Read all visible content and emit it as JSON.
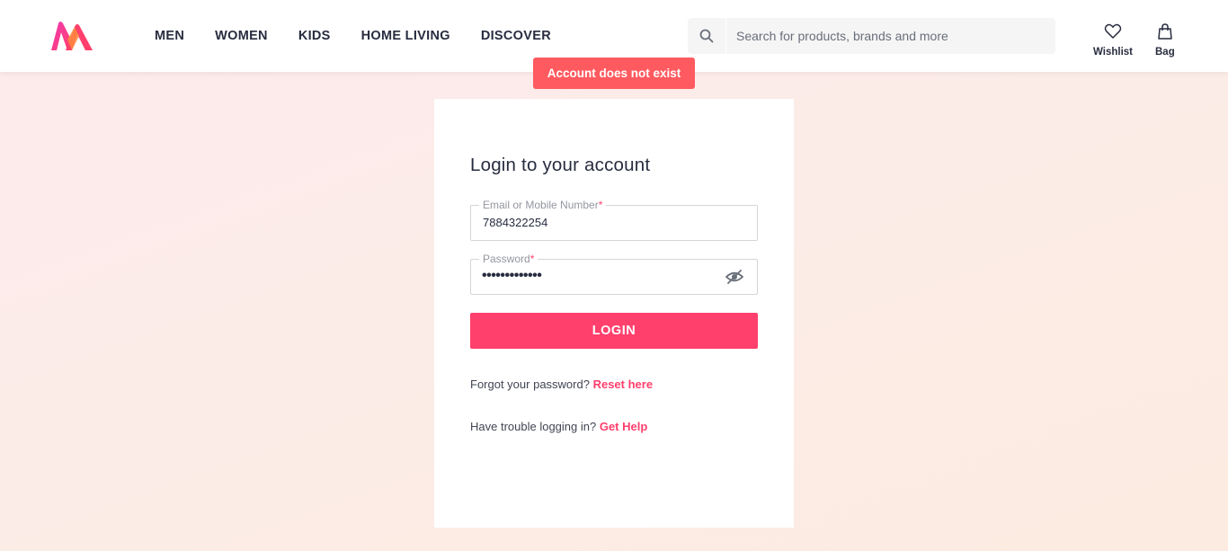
{
  "header": {
    "nav": [
      "MEN",
      "WOMEN",
      "KIDS",
      "HOME LIVING",
      "DISCOVER"
    ],
    "search_placeholder": "Search for products, brands and more",
    "wishlist_label": "Wishlist",
    "bag_label": "Bag"
  },
  "toast": {
    "message": "Account does not exist",
    "color": "#ff5a5f"
  },
  "login": {
    "title": "Login to your account",
    "email_label": "Email or Mobile Number",
    "email_value": "7884322254",
    "password_label": "Password",
    "password_mask": "•••••••••••••",
    "required_mark": "*",
    "login_button": "LOGIN",
    "forgot_text": "Forgot your password?",
    "reset_link": "Reset here",
    "trouble_text": "Have trouble logging in?",
    "help_link": "Get Help"
  },
  "colors": {
    "accent": "#ff3f6c",
    "text": "#282c3f"
  },
  "icons": {
    "search": "search-icon",
    "wishlist": "heart-icon",
    "bag": "bag-icon",
    "password_toggle": "eye-slash-icon"
  }
}
